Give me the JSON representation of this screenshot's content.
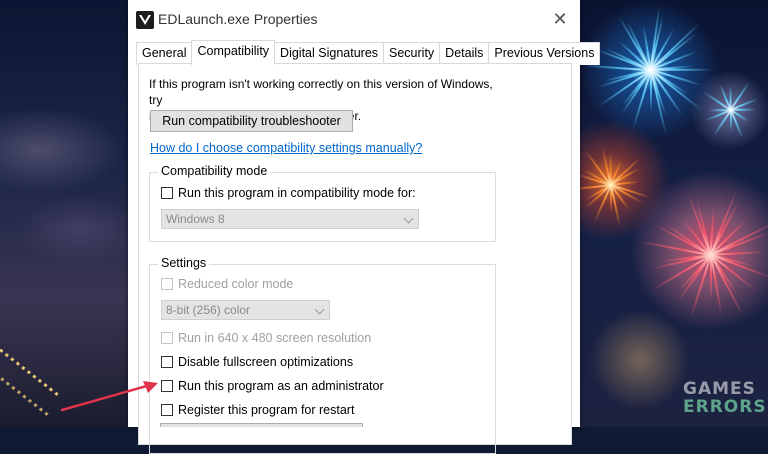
{
  "window": {
    "title": "EDLaunch.exe Properties",
    "close_glyph": "✕"
  },
  "tabs": [
    {
      "label": "General"
    },
    {
      "label": "Compatibility",
      "active": true
    },
    {
      "label": "Digital Signatures"
    },
    {
      "label": "Security"
    },
    {
      "label": "Details"
    },
    {
      "label": "Previous Versions"
    }
  ],
  "compat": {
    "intro_line1": "If this program isn't working correctly on this version of Windows, try",
    "intro_line2": "running the compatibility troubleshooter.",
    "troubleshoot_button": "Run compatibility troubleshooter",
    "help_link": "How do I choose compatibility settings manually?",
    "mode_group_title": "Compatibility mode",
    "mode_checkbox": "Run this program in compatibility mode for:",
    "mode_select_value": "Windows 8",
    "settings_group_title": "Settings",
    "settings": {
      "reduced_color": "Reduced color mode",
      "color_select_value": "8-bit (256) color",
      "res_640": "Run in 640 x 480 screen resolution",
      "disable_fullscreen": "Disable fullscreen optimizations",
      "run_as_admin": "Run this program as an administrator",
      "register_restart": "Register this program for restart"
    }
  },
  "watermark": {
    "line1": "GAMES",
    "line2": "ERRORS"
  },
  "colors": {
    "link": "#0066cc",
    "arrow": "#e0344a"
  }
}
